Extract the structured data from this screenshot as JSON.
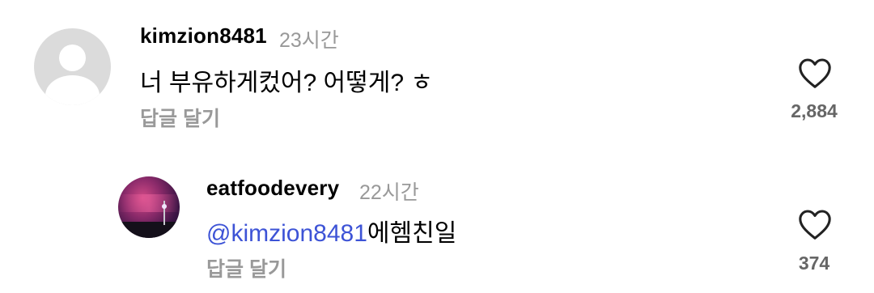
{
  "comments": [
    {
      "username": "kimzion8481",
      "timestamp": "23시간",
      "text": "너 부유하게컸어?  어떻게? ㅎ",
      "reply_label": "답글 달기",
      "like_count": "2,884",
      "avatar": "default-person-icon"
    },
    {
      "username": "eatfoodevery",
      "timestamp": "22시간",
      "mention": "@kimzion8481",
      "text": "에헴친일",
      "reply_label": "답글 달기",
      "like_count": "374",
      "avatar": "sunset-photo"
    }
  ],
  "colors": {
    "mention": "#3d53d6",
    "meta_gray": "#999999",
    "count_gray": "#666666",
    "avatar_bg": "#dbdbdb"
  },
  "icons": {
    "like": "heart-outline-icon"
  }
}
